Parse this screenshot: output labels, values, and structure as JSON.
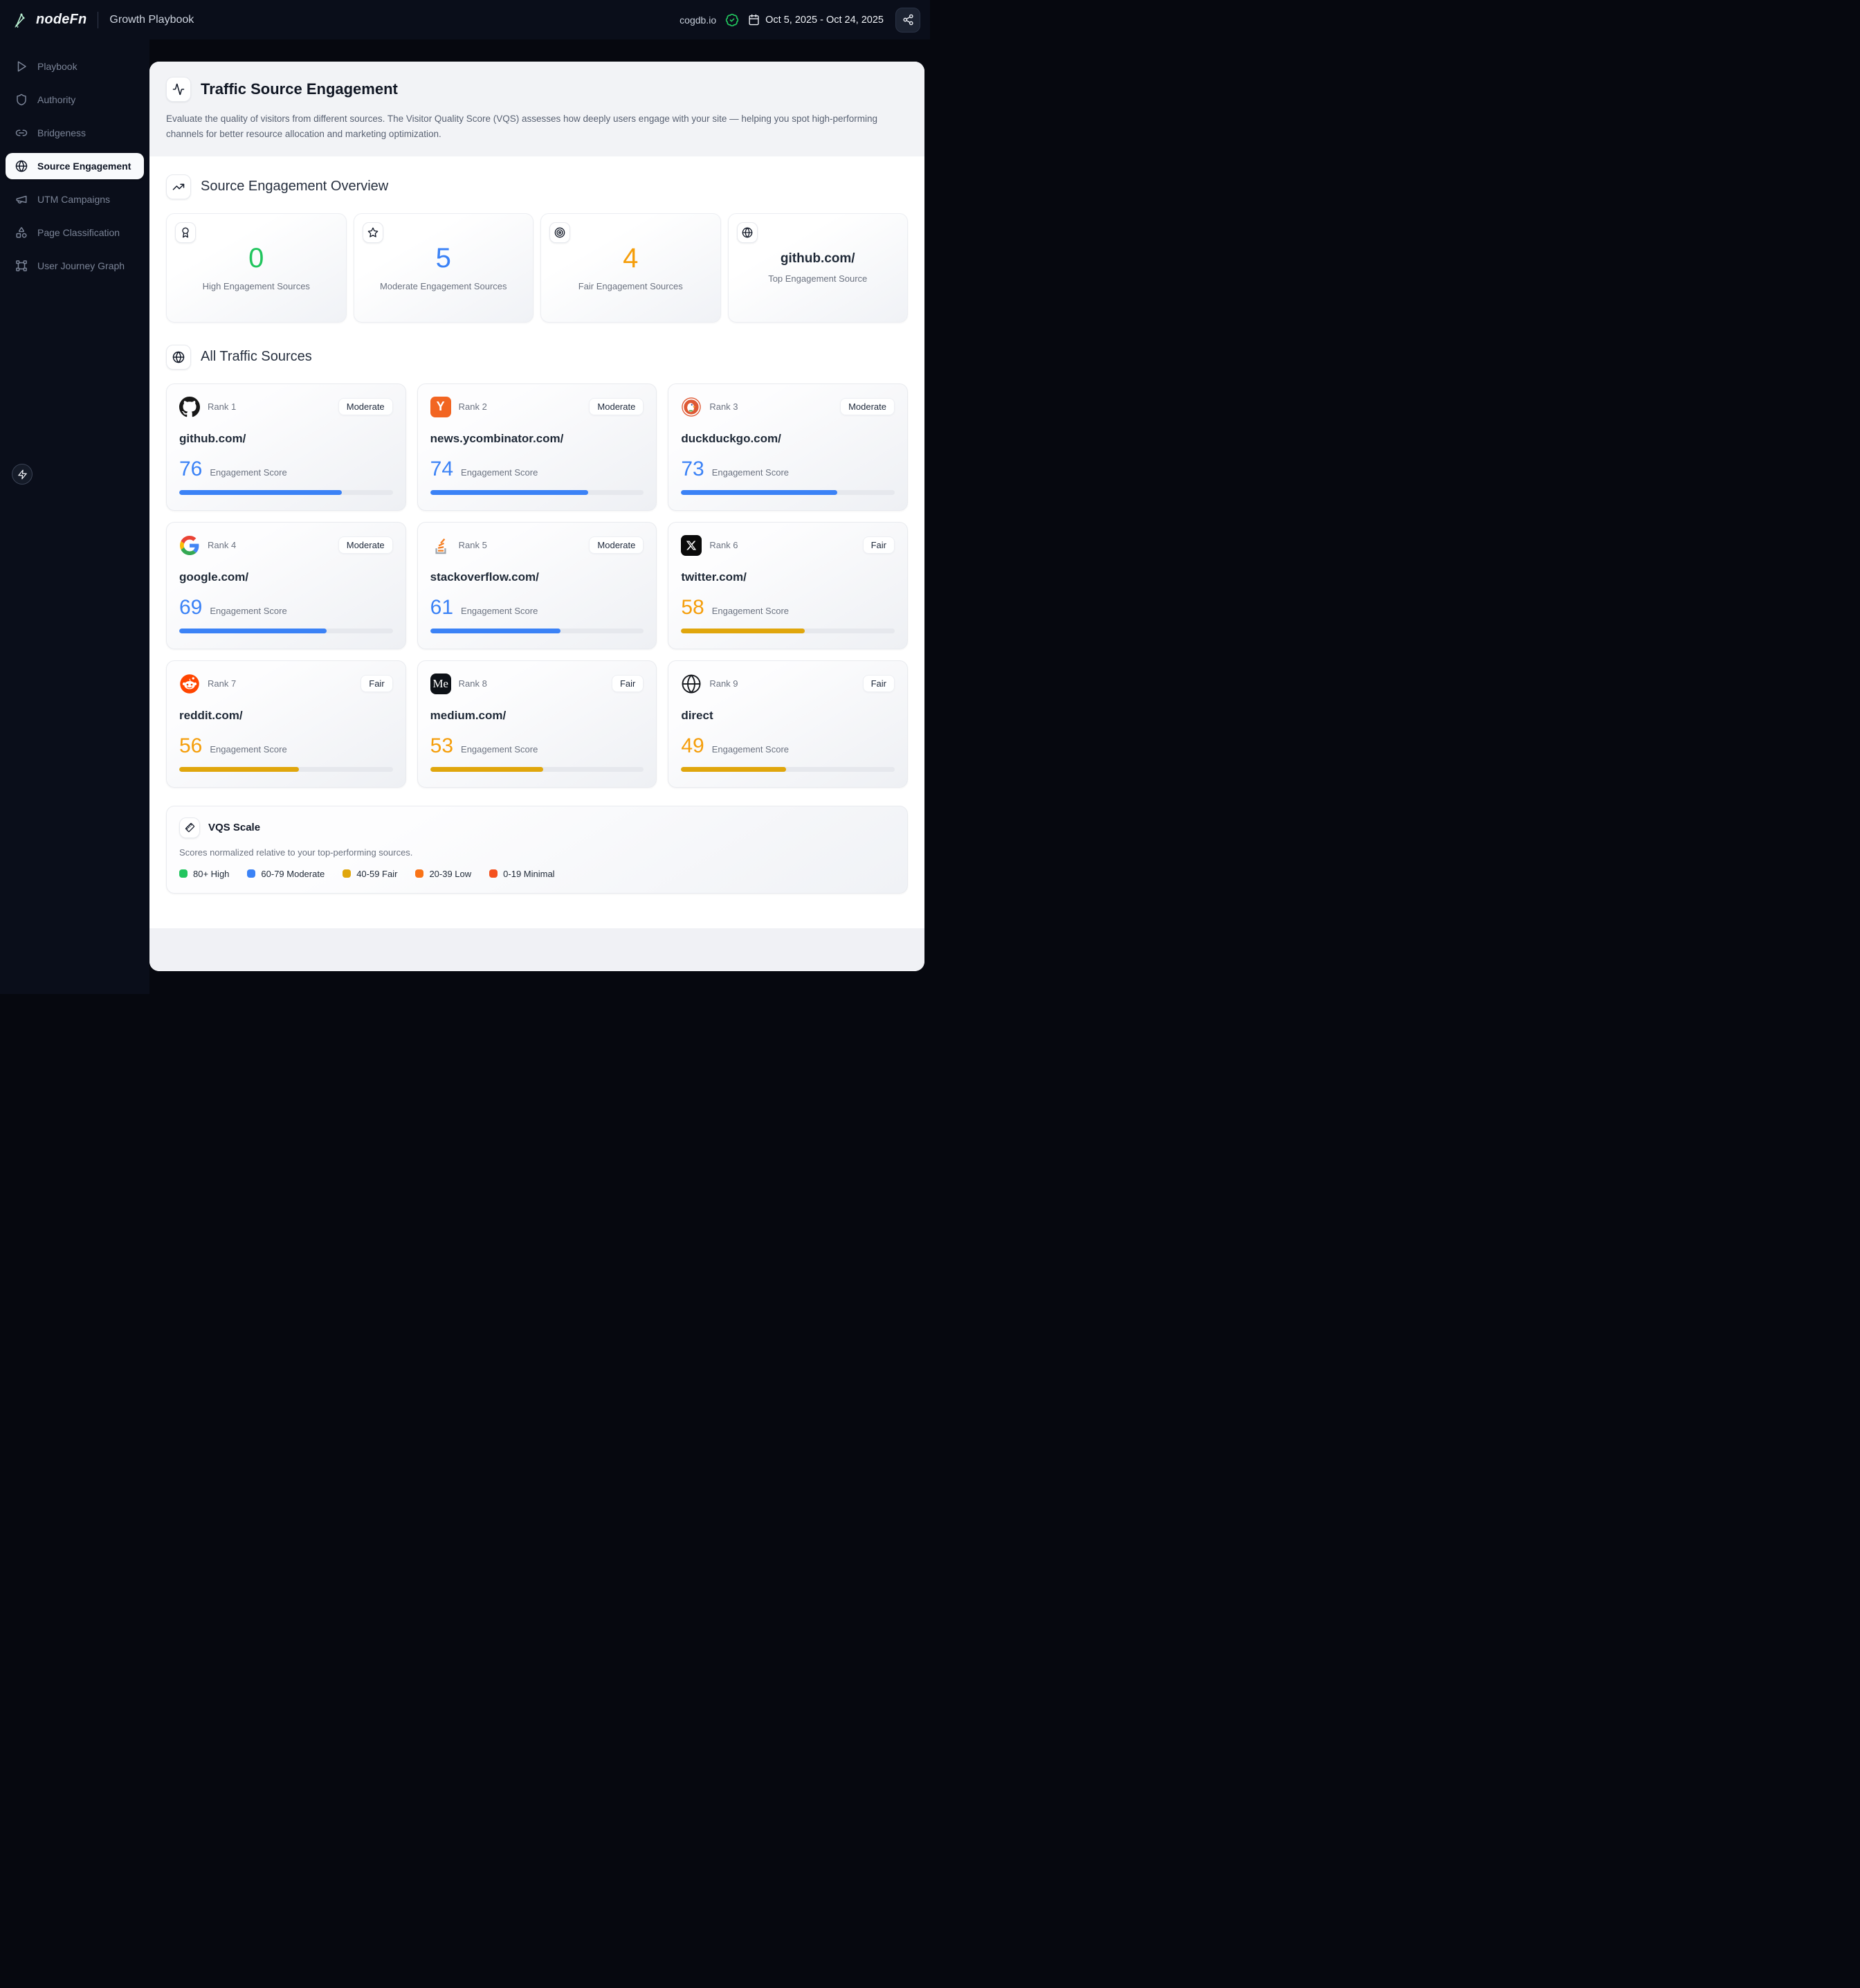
{
  "topbar": {
    "brand": "nodeFn",
    "app": "Growth Playbook",
    "site": "cogdb.io",
    "date_range": "Oct 5, 2025 - Oct 24, 2025"
  },
  "sidebar": {
    "items": [
      {
        "label": "Playbook"
      },
      {
        "label": "Authority"
      },
      {
        "label": "Bridgeness"
      },
      {
        "label": "Source Engagement"
      },
      {
        "label": "UTM Campaigns"
      },
      {
        "label": "Page Classification"
      },
      {
        "label": "User Journey Graph"
      }
    ]
  },
  "page": {
    "title": "Traffic Source Engagement",
    "description": "Evaluate the quality of visitors from different sources. The Visitor Quality Score (VQS) assesses how deeply users engage with your site — helping you spot high-performing channels for better resource allocation and marketing optimization."
  },
  "overview": {
    "title": "Source Engagement Overview",
    "stats": [
      {
        "value": "0",
        "label": "High Engagement Sources",
        "color": "#22c55e"
      },
      {
        "value": "5",
        "label": "Moderate Engagement Sources",
        "color": "#3b82f6"
      },
      {
        "value": "4",
        "label": "Fair Engagement Sources",
        "color": "#f59e0b"
      },
      {
        "value": "github.com/",
        "label": "Top Engagement Source",
        "color": "#1f2937"
      }
    ]
  },
  "sources": {
    "title": "All Traffic Sources",
    "score_label": "Engagement Score",
    "cards": [
      {
        "rank": "Rank 1",
        "domain": "github.com/",
        "score": 76,
        "badge": "Moderate",
        "tier": "moderate"
      },
      {
        "rank": "Rank 2",
        "domain": "news.ycombinator.com/",
        "score": 74,
        "badge": "Moderate",
        "tier": "moderate"
      },
      {
        "rank": "Rank 3",
        "domain": "duckduckgo.com/",
        "score": 73,
        "badge": "Moderate",
        "tier": "moderate"
      },
      {
        "rank": "Rank 4",
        "domain": "google.com/",
        "score": 69,
        "badge": "Moderate",
        "tier": "moderate"
      },
      {
        "rank": "Rank 5",
        "domain": "stackoverflow.com/",
        "score": 61,
        "badge": "Moderate",
        "tier": "moderate"
      },
      {
        "rank": "Rank 6",
        "domain": "twitter.com/",
        "score": 58,
        "badge": "Fair",
        "tier": "fair"
      },
      {
        "rank": "Rank 7",
        "domain": "reddit.com/",
        "score": 56,
        "badge": "Fair",
        "tier": "fair"
      },
      {
        "rank": "Rank 8",
        "domain": "medium.com/",
        "score": 53,
        "badge": "Fair",
        "tier": "fair"
      },
      {
        "rank": "Rank 9",
        "domain": "direct",
        "score": 49,
        "badge": "Fair",
        "tier": "fair"
      }
    ]
  },
  "icon_text": {
    "ycombinator": "Y",
    "medium": "Me"
  },
  "vqs": {
    "title": "VQS Scale",
    "subtitle": "Scores normalized relative to your top-performing sources.",
    "legend": [
      {
        "label": "80+ High",
        "color": "#22c55e"
      },
      {
        "label": "60-79 Moderate",
        "color": "#3b82f6"
      },
      {
        "label": "40-59 Fair",
        "color": "#e0a60c"
      },
      {
        "label": "20-39 Low",
        "color": "#f97316"
      },
      {
        "label": "0-19 Minimal",
        "color": "#f4511e"
      }
    ]
  }
}
